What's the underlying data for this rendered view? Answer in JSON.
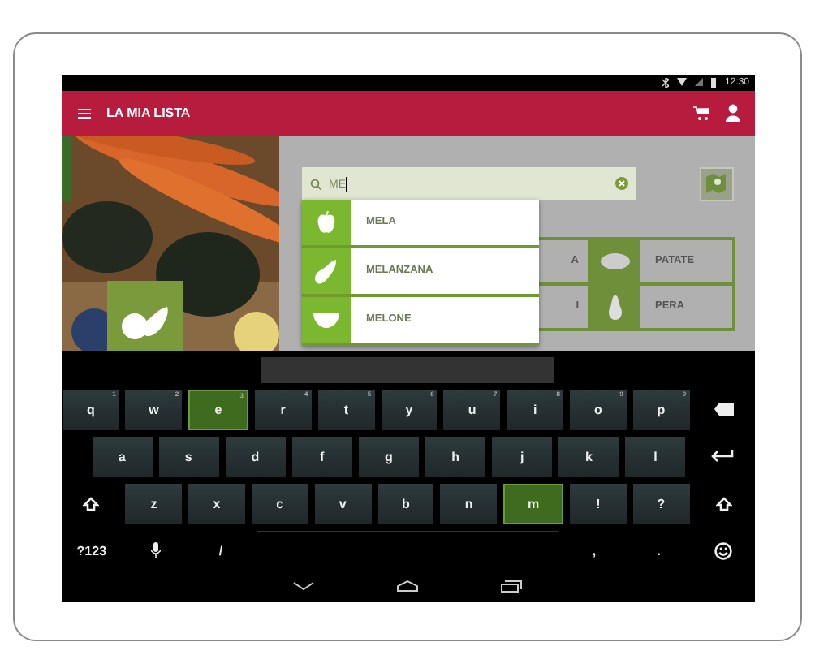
{
  "status_bar": {
    "time": "12:30"
  },
  "app_bar": {
    "title": "LA MIA LISTA"
  },
  "search": {
    "value": "ME"
  },
  "suggestions": [
    {
      "label": "MELA",
      "kind": "apple"
    },
    {
      "label": "MELANZANA",
      "kind": "eggplant"
    },
    {
      "label": "MELONE",
      "kind": "melon"
    }
  ],
  "grid": [
    {
      "label": "A",
      "kind": "none"
    },
    {
      "label": "PATATE",
      "kind": "potato"
    },
    {
      "label": "I",
      "kind": "none"
    },
    {
      "label": "PERA",
      "kind": "pear"
    }
  ],
  "keyboard": [
    [
      {
        "kind": "char",
        "label": "q",
        "hint": "1",
        "highlighted": false
      },
      {
        "kind": "char",
        "label": "w",
        "hint": "2",
        "highlighted": false
      },
      {
        "kind": "char",
        "label": "e",
        "hint": "3",
        "highlighted": true
      },
      {
        "kind": "char",
        "label": "r",
        "hint": "4",
        "highlighted": false
      },
      {
        "kind": "char",
        "label": "t",
        "hint": "5",
        "highlighted": false
      },
      {
        "kind": "char",
        "label": "y",
        "hint": "6",
        "highlighted": false
      },
      {
        "kind": "char",
        "label": "u",
        "hint": "7",
        "highlighted": false
      },
      {
        "kind": "char",
        "label": "i",
        "hint": "8",
        "highlighted": false
      },
      {
        "kind": "char",
        "label": "o",
        "hint": "9",
        "highlighted": false
      },
      {
        "kind": "char",
        "label": "p",
        "hint": "0",
        "highlighted": false
      },
      {
        "kind": "backspace"
      }
    ],
    [
      {
        "kind": "char",
        "label": "a",
        "highlighted": false
      },
      {
        "kind": "char",
        "label": "s",
        "highlighted": false
      },
      {
        "kind": "char",
        "label": "d",
        "highlighted": false
      },
      {
        "kind": "char",
        "label": "f",
        "highlighted": false
      },
      {
        "kind": "char",
        "label": "g",
        "highlighted": false
      },
      {
        "kind": "char",
        "label": "h",
        "highlighted": false
      },
      {
        "kind": "char",
        "label": "j",
        "highlighted": false
      },
      {
        "kind": "char",
        "label": "k",
        "highlighted": false
      },
      {
        "kind": "char",
        "label": "l",
        "highlighted": false
      },
      {
        "kind": "enter"
      }
    ],
    [
      {
        "kind": "shift"
      },
      {
        "kind": "char",
        "label": "z",
        "highlighted": false
      },
      {
        "kind": "char",
        "label": "x",
        "highlighted": false
      },
      {
        "kind": "char",
        "label": "c",
        "highlighted": false
      },
      {
        "kind": "char",
        "label": "v",
        "highlighted": false
      },
      {
        "kind": "char",
        "label": "b",
        "highlighted": false
      },
      {
        "kind": "char",
        "label": "n",
        "highlighted": false
      },
      {
        "kind": "char",
        "label": "m",
        "highlighted": true
      },
      {
        "kind": "char",
        "label": "!",
        "highlighted": false
      },
      {
        "kind": "char",
        "label": "?",
        "highlighted": false
      },
      {
        "kind": "shift"
      }
    ],
    [
      {
        "kind": "flat",
        "label": "?123"
      },
      {
        "kind": "mic"
      },
      {
        "kind": "flat",
        "label": "/"
      },
      {
        "kind": "space"
      },
      {
        "kind": "flat",
        "label": ","
      },
      {
        "kind": "flat",
        "label": "."
      },
      {
        "kind": "emoji"
      }
    ]
  ]
}
